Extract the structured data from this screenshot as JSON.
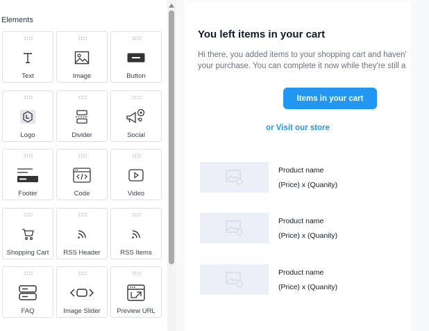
{
  "panel": {
    "title": "Elements"
  },
  "elements": [
    {
      "label": "Text",
      "icon": "text-icon"
    },
    {
      "label": "Image",
      "icon": "image-icon"
    },
    {
      "label": "Button",
      "icon": "button-icon"
    },
    {
      "label": "Logo",
      "icon": "logo-icon"
    },
    {
      "label": "Divider",
      "icon": "divider-icon"
    },
    {
      "label": "Social",
      "icon": "social-icon"
    },
    {
      "label": "Footer",
      "icon": "footer-icon"
    },
    {
      "label": "Code",
      "icon": "code-icon"
    },
    {
      "label": "Video",
      "icon": "video-icon"
    },
    {
      "label": "Shopping Cart",
      "icon": "shopping-cart-icon"
    },
    {
      "label": "RSS Header",
      "icon": "rss-icon"
    },
    {
      "label": "RSS Items",
      "icon": "rss-icon"
    },
    {
      "label": "FAQ",
      "icon": "faq-icon"
    },
    {
      "label": "Image Slider",
      "icon": "image-slider-icon"
    },
    {
      "label": "Preview URL",
      "icon": "preview-url-icon"
    }
  ],
  "email": {
    "title": "You left items in your cart",
    "body_line1": "Hi there, you added items to your shopping cart and haven'",
    "body_line2": "your purchase. You can complete it now while they're still a",
    "cta_label": "Items in your cart",
    "store_link": "or Visit our store",
    "products": [
      {
        "name": "Product name",
        "price": "(Price) x (Quanity)"
      },
      {
        "name": "Product name",
        "price": "(Price) x (Quanity)"
      },
      {
        "name": "Product name",
        "price": "(Price) x (Quanity)"
      }
    ]
  },
  "colors": {
    "accent": "#2196f3",
    "placeholder_bg": "#eceef8",
    "tile_border": "#dde1e7"
  }
}
